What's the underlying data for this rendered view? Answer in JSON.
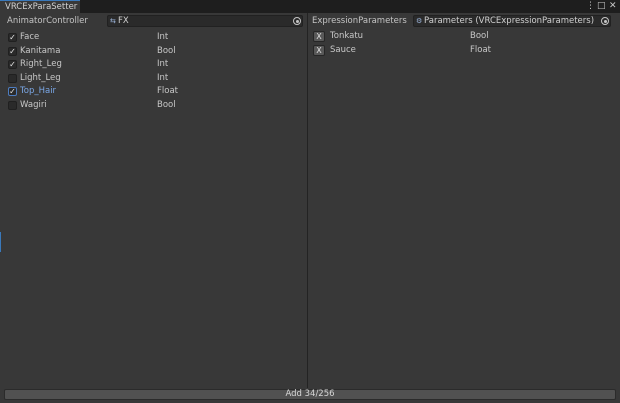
{
  "window": {
    "tab_title": "VRCExParaSetter",
    "controls": {
      "menu": "⋮",
      "maximize": "□",
      "close": "✕"
    }
  },
  "left": {
    "header_label": "AnimatorController",
    "field_value": "FX",
    "params": [
      {
        "name": "Face",
        "type": "Int",
        "checked": true
      },
      {
        "name": "Kanitama",
        "type": "Bool",
        "checked": true
      },
      {
        "name": "Right_Leg",
        "type": "Int",
        "checked": true
      },
      {
        "name": "Light_Leg",
        "type": "Int",
        "checked": false
      },
      {
        "name": "Top_Hair",
        "type": "Float",
        "checked": true
      },
      {
        "name": "Wagiri",
        "type": "Bool",
        "checked": false
      }
    ]
  },
  "right": {
    "header_label": "ExpressionParameters",
    "field_value": "Parameters (VRCExpressionParameters)",
    "remove_label": "X",
    "params": [
      {
        "name": "Tonkatu",
        "type": "Bool"
      },
      {
        "name": "Sauce",
        "type": "Float"
      }
    ]
  },
  "add_button": "Add 34/256",
  "colors": {
    "accent": "#3a79bb",
    "selected_text": "#7aa7e6",
    "background": "#383838"
  }
}
